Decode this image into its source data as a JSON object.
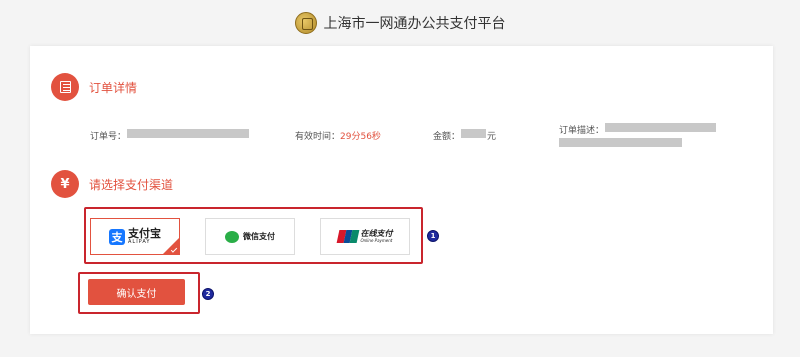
{
  "header": {
    "title": "上海市一网通办公共支付平台",
    "logo_icon": "emblem-icon"
  },
  "order_section": {
    "title": "订单详情",
    "icon": "document-icon",
    "order_no_label": "订单号：",
    "valid_time_label": "有效时间：",
    "valid_time_value": "29分56秒",
    "amount_label": "金额：",
    "amount_unit": "元",
    "description_label": "订单描述："
  },
  "payment_section": {
    "title": "请选择支付渠道",
    "icon": "yen-icon",
    "yen_glyph": "¥",
    "options": [
      {
        "id": "alipay",
        "mark": "支",
        "label": "支付宝",
        "sublabel": "ALIPAY",
        "selected": true
      },
      {
        "id": "wechat",
        "label": "微信支付",
        "selected": false
      },
      {
        "id": "unionpay",
        "label": "在线支付",
        "sublabel": "Online Payment",
        "selected": false
      }
    ]
  },
  "annotations": {
    "step1": "1",
    "step2": "2"
  },
  "confirm_button": {
    "label": "确认支付"
  },
  "colors": {
    "accent": "#e2523f",
    "highlight_box": "#c9252d",
    "badge": "#1f2a9e",
    "alipay": "#1677ff",
    "wechat": "#2aae47"
  }
}
